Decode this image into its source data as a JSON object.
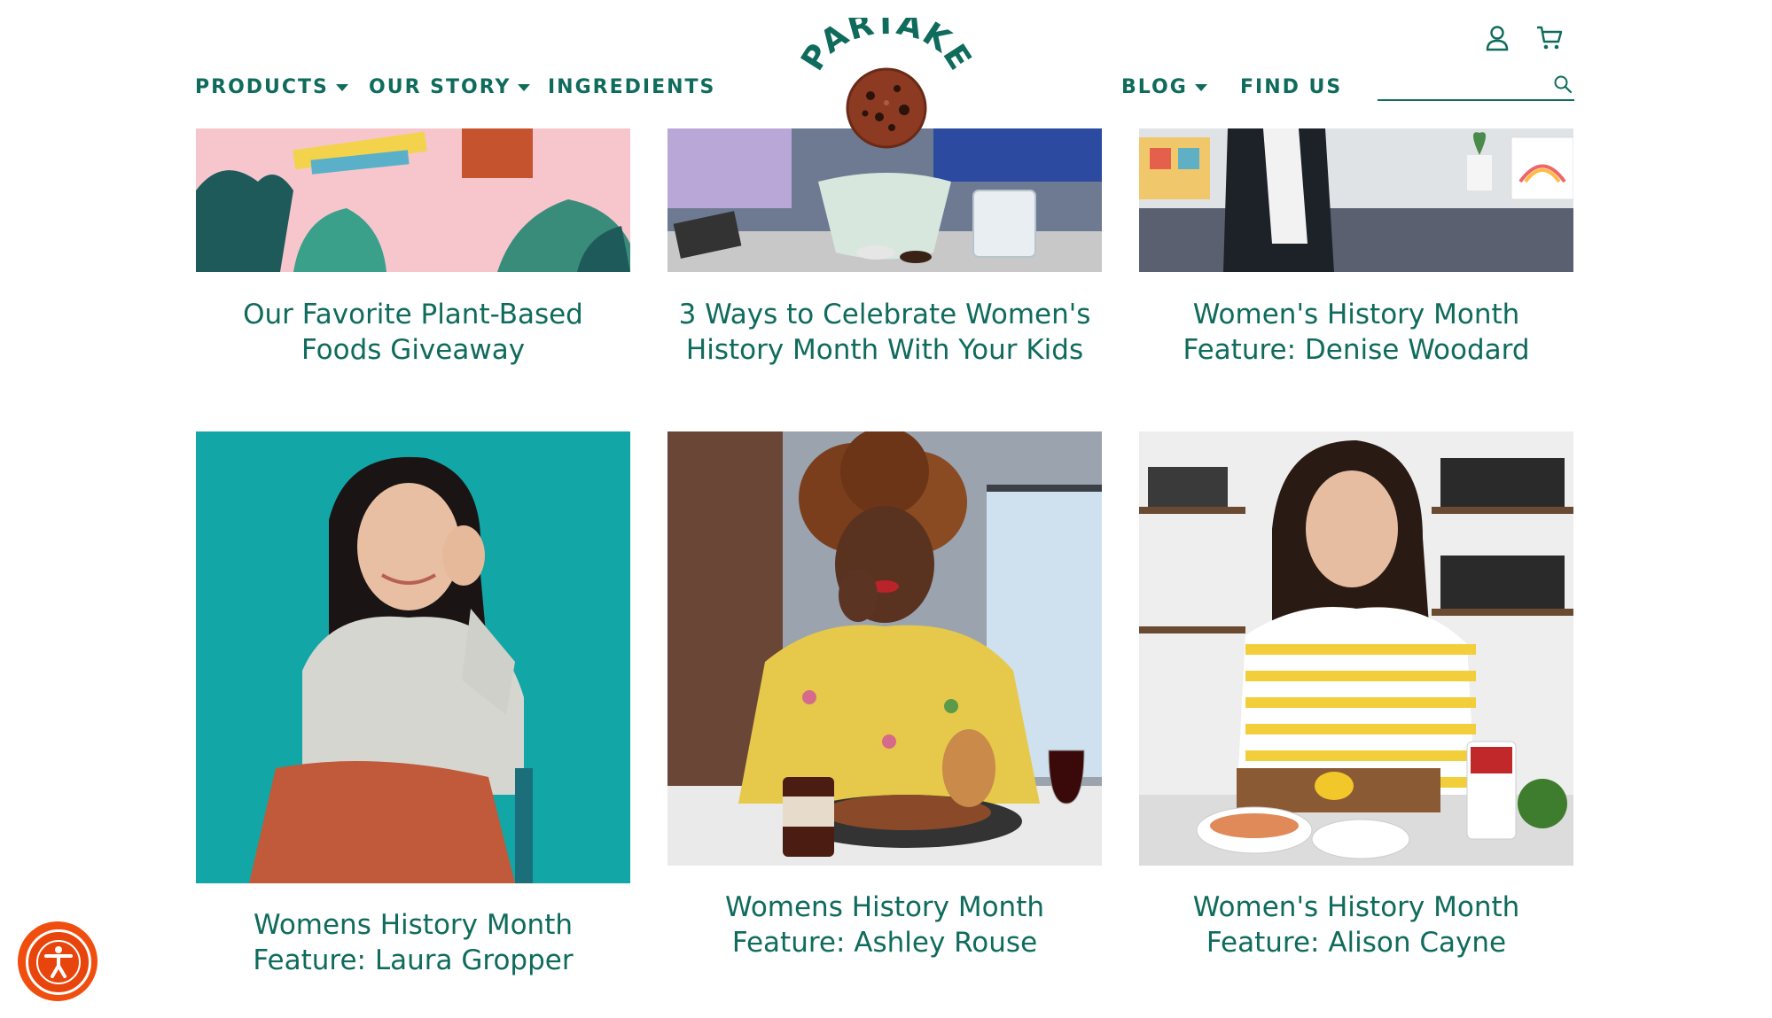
{
  "header": {
    "nav_left": [
      {
        "label": "PRODUCTS",
        "has_dropdown": true
      },
      {
        "label": "OUR STORY",
        "has_dropdown": true
      },
      {
        "label": "INGREDIENTS",
        "has_dropdown": false
      }
    ],
    "nav_right": [
      {
        "label": "BLOG",
        "has_dropdown": true
      },
      {
        "label": "FIND US",
        "has_dropdown": false
      }
    ],
    "logo_text": "PARTAKE",
    "search": {
      "value": "",
      "placeholder": ""
    },
    "icons": [
      "account-icon",
      "cart-icon",
      "search-icon"
    ]
  },
  "posts": [
    {
      "title_line1": "Our Favorite Plant-Based",
      "title_line2": "Foods Giveaway"
    },
    {
      "title_line1": "3 Ways to Celebrate Women's",
      "title_line2": "History Month With Your Kids"
    },
    {
      "title_line1": "Women's History Month",
      "title_line2": "Feature: Denise Woodard"
    },
    {
      "title_line1": "Womens History Month",
      "title_line2": "Feature: Laura Gropper"
    },
    {
      "title_line1": "Womens History Month",
      "title_line2": "Feature: Ashley Rouse"
    },
    {
      "title_line1": "Women's History Month",
      "title_line2": "Feature: Alison Cayne"
    }
  ],
  "colors": {
    "brand_green": "#0f6b5c",
    "accessibility_orange": "#f04e0f",
    "teal_background": "#11a3a3",
    "pink_background": "#f7c6cd"
  }
}
